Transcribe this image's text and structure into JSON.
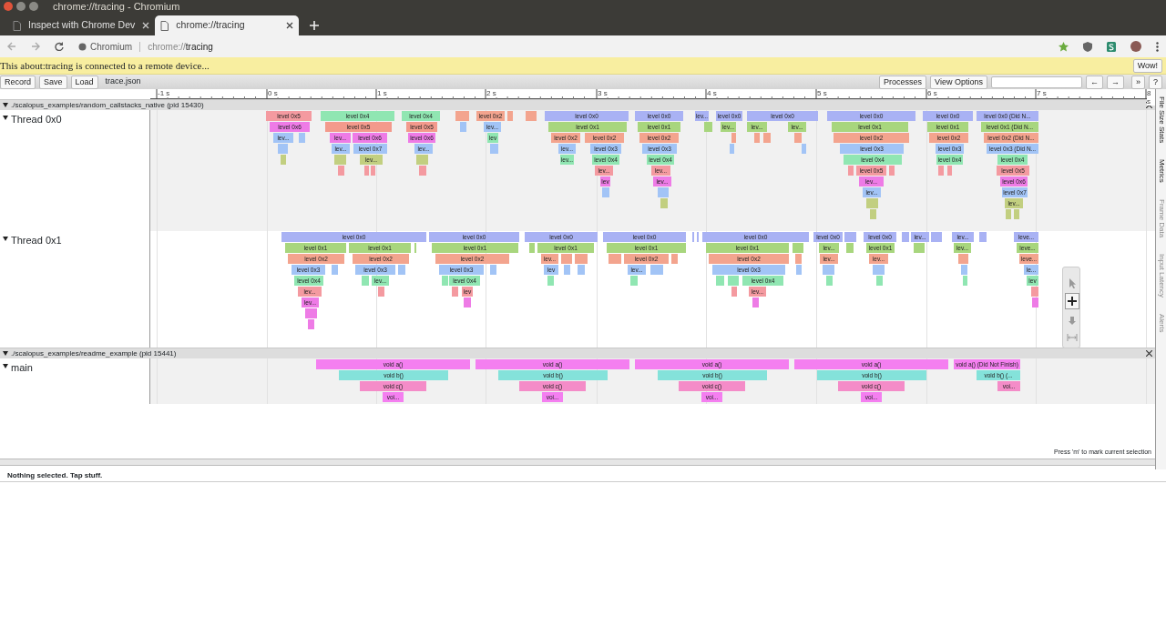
{
  "window": {
    "title": "chrome://tracing - Chromium"
  },
  "tabs": [
    {
      "label": "Inspect with Chrome Dev",
      "selected": false
    },
    {
      "label": "chrome://tracing",
      "selected": true
    }
  ],
  "address_bar": {
    "site": "Chromium",
    "url_prefix": "chrome://",
    "url_host": "tracing"
  },
  "infobar": {
    "message": "This about:tracing is connected to a remote device...",
    "button": "Wow!"
  },
  "toolbar": {
    "buttons": [
      "Record",
      "Save",
      "Load"
    ],
    "filename": "trace.json",
    "right_buttons": [
      "Processes",
      "View Options"
    ],
    "nav_buttons": [
      "←",
      "→",
      "»",
      "?"
    ]
  },
  "ruler": {
    "ticks": [
      "-1 s",
      "0 s",
      "1 s",
      "2 s",
      "3 s",
      "4 s",
      "5 s",
      "6 s",
      "7 s",
      "8 s"
    ]
  },
  "processes": [
    {
      "name": "./scalopus_examples/random_callstacks_native (pid 15430)",
      "expanded": true,
      "threads": [
        {
          "name": "Thread 0x0",
          "expanded": true,
          "slices": [
            {
              "label": "level 0x5",
              "color": "#f49aa0"
            },
            {
              "label": "level 0x4",
              "color": "#90e6b2"
            },
            {
              "label": "level 0x4",
              "color": "#90e6b2"
            },
            {
              "label": "level 0x2",
              "color": "#f3a48e"
            },
            {
              "label": "level 0x0",
              "color": "#a9b2f4"
            },
            {
              "label": "level 0x0",
              "color": "#a9b2f4"
            },
            {
              "label": "lev...",
              "color": "#a9b2f4"
            },
            {
              "label": "level 0x0",
              "color": "#a9b2f4"
            },
            {
              "label": "level 0x0",
              "color": "#a9b2f4"
            },
            {
              "label": "level 0x0",
              "color": "#a9b2f4"
            },
            {
              "label": "level 0x0",
              "color": "#a9b2f4"
            },
            {
              "label": "level 0x0 (Did N...",
              "color": "#a9b2f4"
            },
            {
              "label": "level 0x6",
              "color": "#ee7be6"
            },
            {
              "label": "level 0x5",
              "color": "#f39a8c"
            },
            {
              "label": "level 0x5",
              "color": "#f39a8c"
            },
            {
              "label": "lev...",
              "color": "#a2c4f6"
            },
            {
              "label": "level 0x1",
              "color": "#a8d67e"
            },
            {
              "label": "level 0x1",
              "color": "#a8d67e"
            },
            {
              "label": "lev...",
              "color": "#a8d67e"
            },
            {
              "label": "lev...",
              "color": "#a8d67e"
            },
            {
              "label": "lev...",
              "color": "#a8d67e"
            },
            {
              "label": "level 0x1",
              "color": "#a8d67e"
            },
            {
              "label": "level 0x1",
              "color": "#a8d67e"
            },
            {
              "label": "level 0x1 (Did N...",
              "color": "#a8d67e"
            },
            {
              "label": "lev...",
              "color": "#a2c4f6"
            },
            {
              "label": "lev...",
              "color": "#ee7be6"
            },
            {
              "label": "level 0x6",
              "color": "#ee7be6"
            },
            {
              "label": "level 0x6",
              "color": "#ee7be6"
            },
            {
              "label": "lev",
              "color": "#90e6b2"
            },
            {
              "label": "level 0x2",
              "color": "#f3a48e"
            },
            {
              "label": "level 0x2",
              "color": "#f3a48e"
            },
            {
              "label": "level 0x2",
              "color": "#f3a48e"
            },
            {
              "label": "level 0x2",
              "color": "#f3a48e"
            },
            {
              "label": "level 0x2",
              "color": "#f3a48e"
            },
            {
              "label": "level 0x2 (Did N...",
              "color": "#f3a48e"
            },
            {
              "label": "lev...",
              "color": "#a2c4f6"
            },
            {
              "label": "level 0x7",
              "color": "#a2c4f6"
            },
            {
              "label": "lev...",
              "color": "#a2c4f6"
            },
            {
              "label": "lev...",
              "color": "#a2c4f6"
            },
            {
              "label": "level 0x3",
              "color": "#a2c4f6"
            },
            {
              "label": "level 0x3",
              "color": "#a2c4f6"
            },
            {
              "label": "level 0x3",
              "color": "#a2c4f6"
            },
            {
              "label": "level 0x3",
              "color": "#a2c4f6"
            },
            {
              "label": "level 0x3 (Did N...",
              "color": "#a2c4f6"
            },
            {
              "label": "lev...",
              "color": "#c2cf80"
            },
            {
              "label": "lev...",
              "color": "#90e6b2"
            },
            {
              "label": "level 0x4",
              "color": "#90e6b2"
            },
            {
              "label": "level 0x4",
              "color": "#90e6b2"
            },
            {
              "label": "level 0x4",
              "color": "#90e6b2"
            },
            {
              "label": "level 0x4",
              "color": "#90e6b2"
            },
            {
              "label": "level 0x4",
              "color": "#90e6b2"
            },
            {
              "label": "lev...",
              "color": "#f49aa0"
            },
            {
              "label": "lev...",
              "color": "#f49aa0"
            },
            {
              "label": "level 0x5",
              "color": "#f49aa0"
            },
            {
              "label": "level 0x5",
              "color": "#f49aa0"
            },
            {
              "label": "lev",
              "color": "#ee7be6"
            },
            {
              "label": "lev...",
              "color": "#ee7be6"
            },
            {
              "label": "lev...",
              "color": "#ee7be6"
            },
            {
              "label": "level 0x6",
              "color": "#ee7be6"
            },
            {
              "label": "lev...",
              "color": "#a2c4f6"
            },
            {
              "label": "level 0x7",
              "color": "#a2c4f6"
            },
            {
              "label": "lev...",
              "color": "#c2cf80"
            }
          ]
        },
        {
          "name": "Thread 0x1",
          "expanded": true,
          "slices": [
            {
              "label": "level 0x0",
              "color": "#a9b2f4"
            },
            {
              "label": "level 0x0",
              "color": "#a9b2f4"
            },
            {
              "label": "level 0x0",
              "color": "#a9b2f4"
            },
            {
              "label": "level 0x0",
              "color": "#a9b2f4"
            },
            {
              "label": "level 0x0",
              "color": "#a9b2f4"
            },
            {
              "label": "level 0x0",
              "color": "#a9b2f4"
            },
            {
              "label": "level 0x0",
              "color": "#a9b2f4"
            },
            {
              "label": "lev...",
              "color": "#a9b2f4"
            },
            {
              "label": "lev...",
              "color": "#a9b2f4"
            },
            {
              "label": "leve...",
              "color": "#a9b2f4"
            },
            {
              "label": "level 0x1",
              "color": "#a8d67e"
            },
            {
              "label": "level 0x1",
              "color": "#a8d67e"
            },
            {
              "label": "level 0x1",
              "color": "#a8d67e"
            },
            {
              "label": "level 0x1",
              "color": "#a8d67e"
            },
            {
              "label": "level 0x1",
              "color": "#a8d67e"
            },
            {
              "label": "level 0x1",
              "color": "#a8d67e"
            },
            {
              "label": "lev...",
              "color": "#a8d67e"
            },
            {
              "label": "level 0x1",
              "color": "#a8d67e"
            },
            {
              "label": "lev...",
              "color": "#a8d67e"
            },
            {
              "label": "leve...",
              "color": "#a8d67e"
            },
            {
              "label": "level 0x2",
              "color": "#f3a48e"
            },
            {
              "label": "level 0x2",
              "color": "#f3a48e"
            },
            {
              "label": "level 0x2",
              "color": "#f3a48e"
            },
            {
              "label": "lev...",
              "color": "#f3a48e"
            },
            {
              "label": "level 0x2",
              "color": "#f3a48e"
            },
            {
              "label": "level 0x2",
              "color": "#f3a48e"
            },
            {
              "label": "lev...",
              "color": "#f3a48e"
            },
            {
              "label": "lev...",
              "color": "#f3a48e"
            },
            {
              "label": "leve...",
              "color": "#f3a48e"
            },
            {
              "label": "level 0x3",
              "color": "#a2c4f6"
            },
            {
              "label": "level 0x3",
              "color": "#a2c4f6"
            },
            {
              "label": "level 0x3",
              "color": "#a2c4f6"
            },
            {
              "label": "lev",
              "color": "#a2c4f6"
            },
            {
              "label": "lev...",
              "color": "#a2c4f6"
            },
            {
              "label": "level 0x3",
              "color": "#a2c4f6"
            },
            {
              "label": "le...",
              "color": "#a2c4f6"
            },
            {
              "label": "level 0x4",
              "color": "#90e6b2"
            },
            {
              "label": "lev...",
              "color": "#90e6b2"
            },
            {
              "label": "level 0x4",
              "color": "#90e6b2"
            },
            {
              "label": "level 0x4",
              "color": "#90e6b2"
            },
            {
              "label": "lev",
              "color": "#90e6b2"
            },
            {
              "label": "lev...",
              "color": "#f49aa0"
            },
            {
              "label": "lev",
              "color": "#f49aa0"
            },
            {
              "label": "lev...",
              "color": "#f49aa0"
            },
            {
              "label": "lev...",
              "color": "#ee7be6"
            }
          ]
        }
      ]
    },
    {
      "name": "./scalopus_examples/readme_example (pid 15441)",
      "expanded": true,
      "threads": [
        {
          "name": "main",
          "expanded": true,
          "slices": [
            {
              "label": "void a()",
              "color": "#f47ff0"
            },
            {
              "label": "void a()",
              "color": "#f47ff0"
            },
            {
              "label": "void a()",
              "color": "#f47ff0"
            },
            {
              "label": "void a()",
              "color": "#f47ff0"
            },
            {
              "label": "void a() (Did Not Finish)",
              "color": "#f47ff0"
            },
            {
              "label": "void b()",
              "color": "#84e2da"
            },
            {
              "label": "void b()",
              "color": "#84e2da"
            },
            {
              "label": "void b()",
              "color": "#84e2da"
            },
            {
              "label": "void b()",
              "color": "#84e2da"
            },
            {
              "label": "void b() (...",
              "color": "#84e2da"
            },
            {
              "label": "void c()",
              "color": "#f48cc8"
            },
            {
              "label": "void c()",
              "color": "#f48cc8"
            },
            {
              "label": "void c()",
              "color": "#f48cc8"
            },
            {
              "label": "void c()",
              "color": "#f48cc8"
            },
            {
              "label": "voi...",
              "color": "#f48cc8"
            },
            {
              "label": "voi...",
              "color": "#f47ff0"
            },
            {
              "label": "voi...",
              "color": "#f47ff0"
            },
            {
              "label": "voi...",
              "color": "#f47ff0"
            },
            {
              "label": "voi...",
              "color": "#f47ff0"
            }
          ]
        }
      ]
    }
  ],
  "mouse_modes": [
    {
      "kind": "select",
      "selected": false
    },
    {
      "kind": "zoom",
      "selected": true
    },
    {
      "kind": "pan",
      "selected": false
    },
    {
      "kind": "timing",
      "selected": false
    }
  ],
  "side_tabs": [
    {
      "label": "File Size Stats",
      "enabled": true
    },
    {
      "label": "Metrics",
      "enabled": true
    },
    {
      "label": "Frame Data",
      "enabled": false
    },
    {
      "label": "Input Latency",
      "enabled": false
    },
    {
      "label": "Alerts",
      "enabled": false
    }
  ],
  "hint": "Press 'm' to mark current selection",
  "status": "Nothing selected. Tap stuff."
}
